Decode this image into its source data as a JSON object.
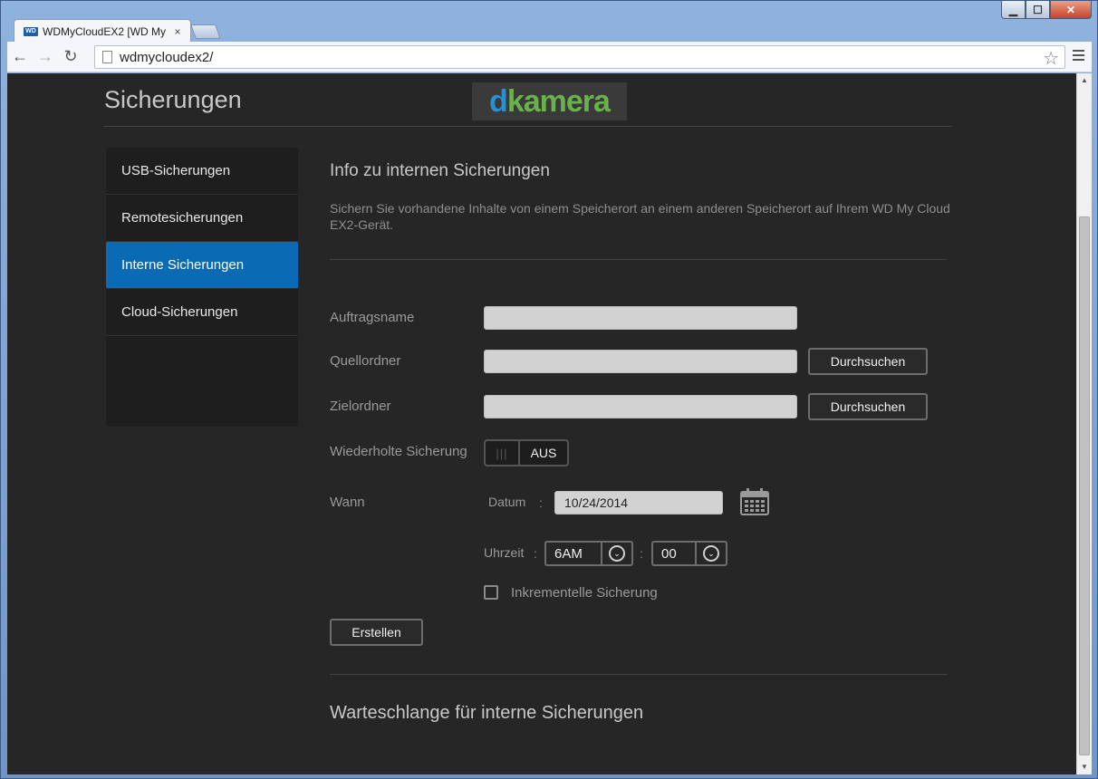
{
  "browser": {
    "tab_title": "WDMyCloudEX2 [WD My",
    "tab_close": "×",
    "favicon_text": "WD",
    "url": "wdmycloudex2/",
    "back": "←",
    "forward": "→",
    "reload": "↻",
    "star": "☆",
    "window_min": "▁",
    "window_max": "☐",
    "window_close": "✕"
  },
  "header": {
    "page_title": "Sicherungen",
    "logo_d": "d",
    "logo_rest": "kamera"
  },
  "sidebar": {
    "items": [
      {
        "label": "USB-Sicherungen"
      },
      {
        "label": "Remotesicherungen"
      },
      {
        "label": "Interne Sicherungen"
      },
      {
        "label": "Cloud-Sicherungen"
      }
    ]
  },
  "main": {
    "title": "Info zu internen Sicherungen",
    "description": "Sichern Sie vorhandene Inhalte von einem Speicherort an einem anderen Speicherort auf Ihrem WD My Cloud EX2-Gerät.",
    "job_name_label": "Auftragsname",
    "job_name_value": "",
    "source_label": "Quellordner",
    "source_value": "",
    "target_label": "Zielordner",
    "target_value": "",
    "browse_label": "Durchsuchen",
    "repeat_label": "Wiederholte Sicherung",
    "toggle_knob": "|||",
    "toggle_state": "AUS",
    "when_label": "Wann",
    "date_label": "Datum",
    "colon": ":",
    "date_value": "10/24/2014",
    "time_label": "Uhrzeit",
    "hour_value": "6AM",
    "minute_value": "00",
    "chevron": "⌄",
    "incremental_label": "Inkrementelle Sicherung",
    "incremental_checked": false,
    "create_label": "Erstellen",
    "queue_title": "Warteschlange für interne Sicherungen"
  },
  "icons": {
    "calendar": "calendar-icon",
    "chevron": "chevron-down-icon"
  },
  "colors": {
    "accent": "#0a6ab3",
    "background": "#262626",
    "logo_blue": "#2a8fd0",
    "logo_green": "#6ab04c"
  }
}
